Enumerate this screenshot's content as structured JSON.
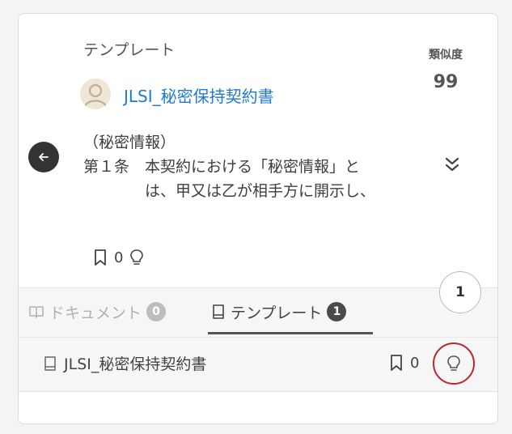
{
  "card": {
    "section_label": "テンプレート",
    "similarity_label": "類似度",
    "similarity_value": "99",
    "title": "JLSI_秘密保持契約書",
    "snippet_lines": [
      "（秘密情報）",
      "第１条　本契約における「秘密情報」と",
      "　　　　は、甲又は乙が相手方に開示し、"
    ],
    "bookmark_count": "0"
  },
  "tabs": [
    {
      "label": "ドキュメント",
      "count": "0",
      "icon": "book-open-icon",
      "active": false
    },
    {
      "label": "テンプレート",
      "count": "1",
      "icon": "template-icon",
      "active": true
    }
  ],
  "floating_count": "1",
  "results": [
    {
      "title": "JLSI_秘密保持契約書",
      "bookmark_count": "0"
    }
  ],
  "colors": {
    "link": "#1f7ad1",
    "highlight": "#b8282d",
    "dark": "#333333"
  }
}
